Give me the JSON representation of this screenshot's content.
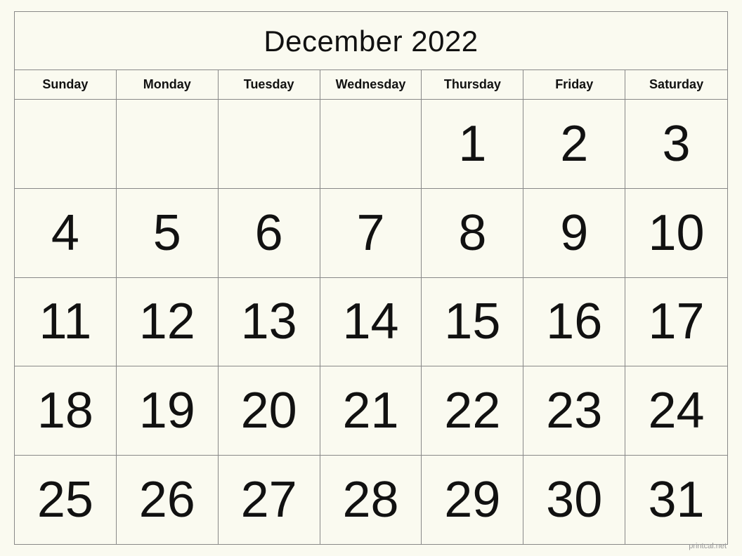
{
  "calendar": {
    "title": "December 2022",
    "days_of_week": [
      "Sunday",
      "Monday",
      "Tuesday",
      "Wednesday",
      "Thursday",
      "Friday",
      "Saturday"
    ],
    "weeks": [
      [
        "",
        "",
        "",
        "",
        "1",
        "2",
        "3"
      ],
      [
        "4",
        "5",
        "6",
        "7",
        "8",
        "9",
        "10"
      ],
      [
        "11",
        "12",
        "13",
        "14",
        "15",
        "16",
        "17"
      ],
      [
        "18",
        "19",
        "20",
        "21",
        "22",
        "23",
        "24"
      ],
      [
        "25",
        "26",
        "27",
        "28",
        "29",
        "30",
        "31"
      ]
    ]
  },
  "watermark": "printcal.net"
}
